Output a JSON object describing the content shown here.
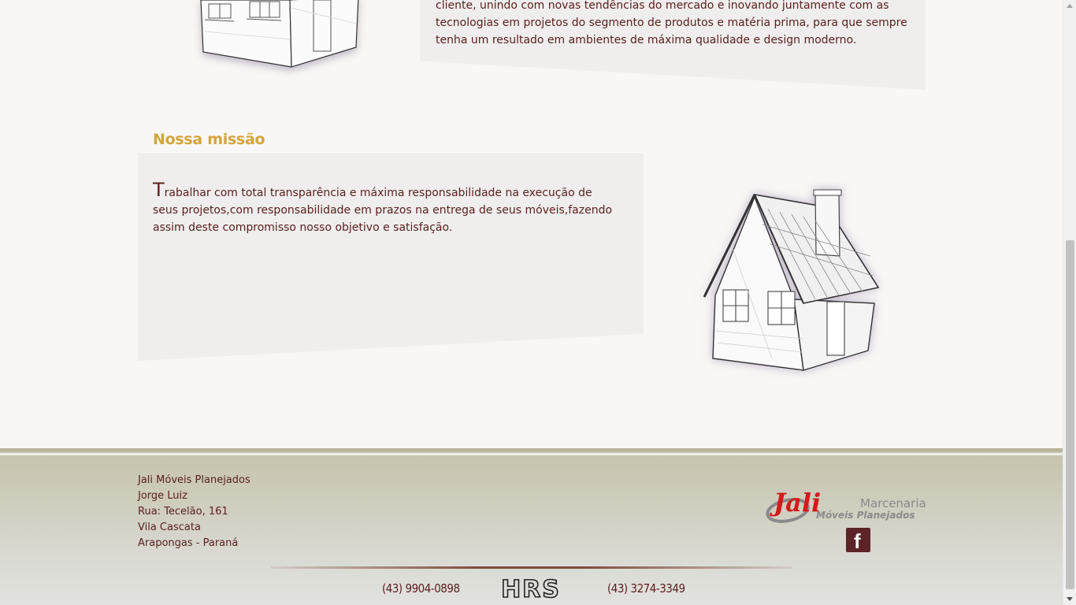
{
  "about": {
    "text": "cliente, unindo com novas tendências do mercado e inovando juntamente com as tecnologias em projetos do segmento de produtos e matéria prima, para que sempre tenha um resultado em ambientes de máxima qualidade e design moderno."
  },
  "mission": {
    "title": "Nossa missão",
    "dropcap": "T",
    "text": "rabalhar com total transparência e máxima responsabilidade na execução de seus projetos,com responsabilidade em prazos na entrega de seus móveis,fazendo assim deste compromisso nosso objetivo e satisfação."
  },
  "footer": {
    "address": [
      "Jali Móveis Planejados",
      "Jorge Luiz",
      "Rua: Tecelão, 161",
      "Vila Cascata",
      "Arapongas - Paraná"
    ],
    "logo": {
      "brand": "Jali",
      "line1": "Marcenaria",
      "line2": "Móveis Planejados"
    },
    "facebook_icon": "facebook-icon",
    "phone1": "(43) 9904-0898",
    "phone2": "(43) 3274-3349",
    "credit": "HRS"
  },
  "colors": {
    "accent": "#d4a53c",
    "text": "#5a2020",
    "footer_bg": "#c5c2ab",
    "facebook_bg": "#5b2427"
  }
}
